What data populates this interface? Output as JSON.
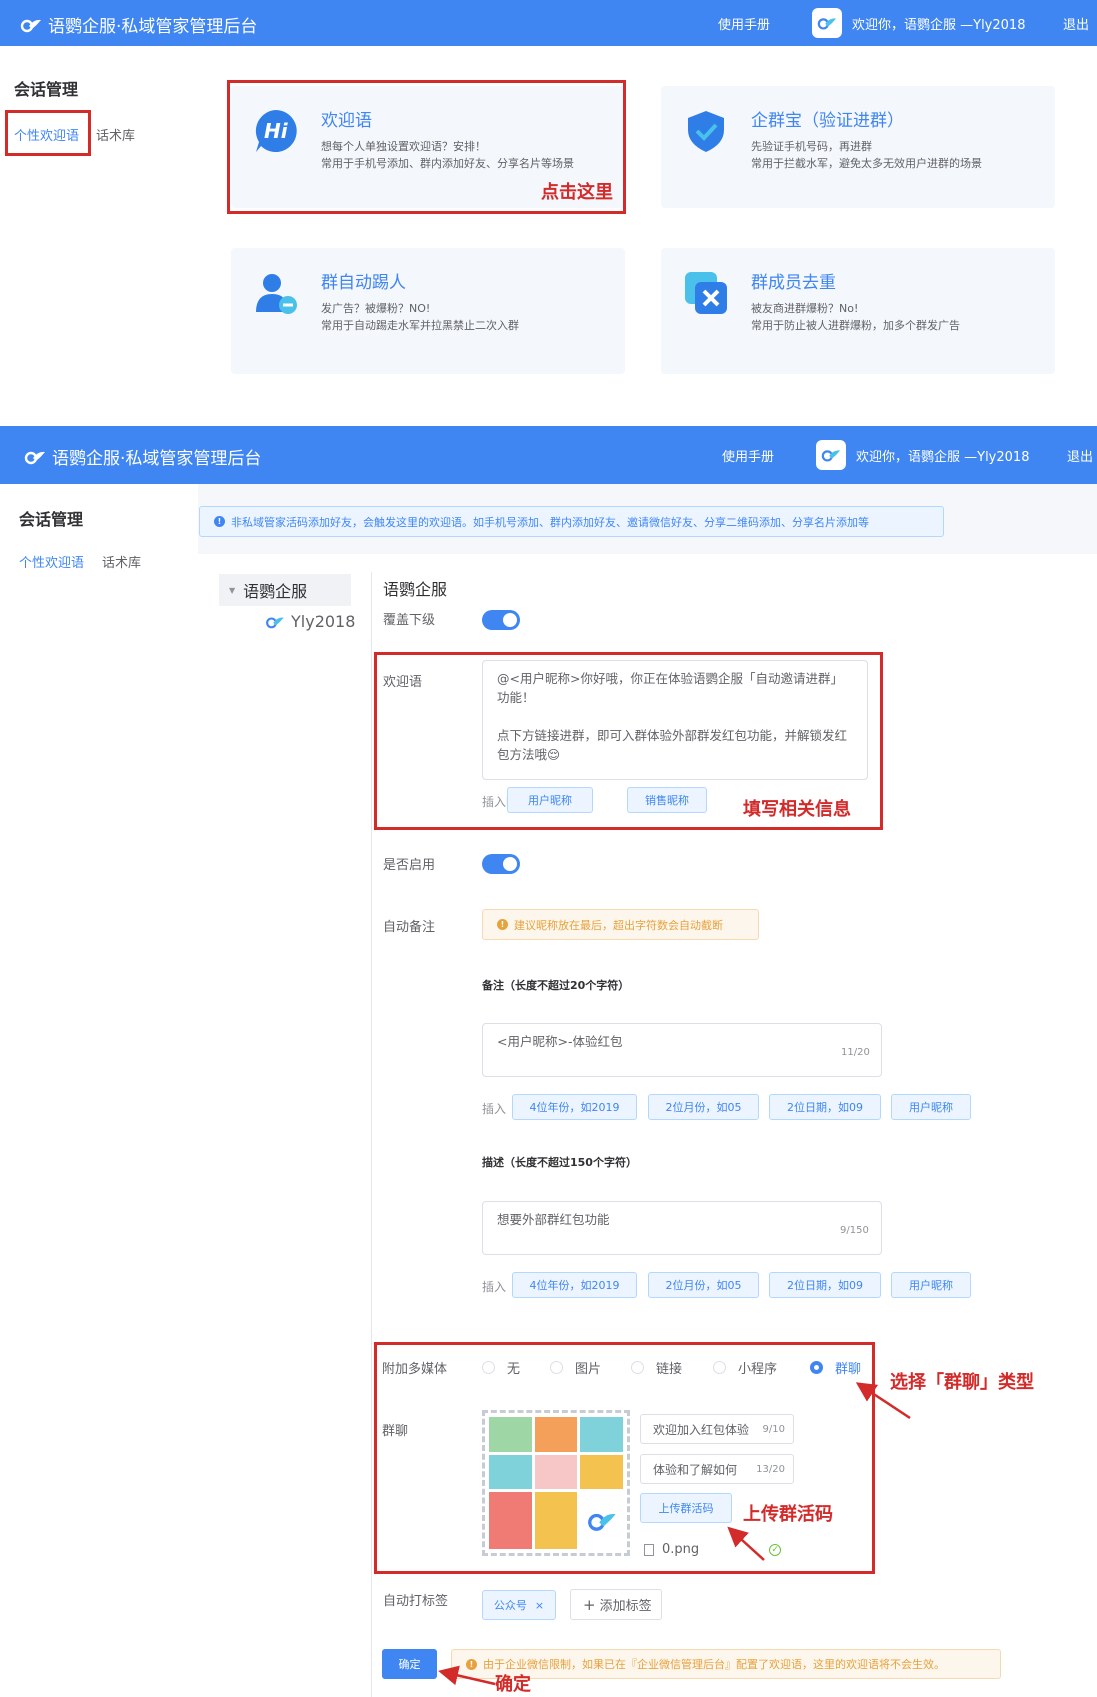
{
  "header": {
    "title": "语鹦企服·私域管家管理后台",
    "manual": "使用手册",
    "welcome": "欢迎你，语鹦企服 —Yly2018",
    "logout": "退出"
  },
  "sidebar": {
    "title": "会话管理",
    "items": [
      {
        "label": "个性欢迎语"
      },
      {
        "label": "话术库"
      }
    ]
  },
  "cards": [
    {
      "title": "欢迎语",
      "desc1": "想每个人单独设置欢迎语？安排！",
      "desc2": "常用于手机号添加、群内添加好友、分享名片等场景",
      "icon": "hi-bubble-icon"
    },
    {
      "title": "企群宝（验证进群）",
      "desc1": "先验证手机号码，再进群",
      "desc2": "常用于拦截水军，避免太多无效用户进群的场景",
      "icon": "shield-check-icon"
    },
    {
      "title": "群自动踢人",
      "desc1": "发广告？被爆粉？NO!",
      "desc2": "常用于自动踢走水军并拉黑禁止二次入群",
      "icon": "user-remove-icon"
    },
    {
      "title": "群成员去重",
      "desc1": "被友商进群爆粉？No!",
      "desc2": "常用于防止被人进群爆粉，加多个群发广告",
      "icon": "dedupe-x-icon"
    }
  ],
  "annotations": {
    "click_here": "点击这里",
    "fill_info": "填写相关信息",
    "select_group": "选择「群聊」类型",
    "upload_code": "上传群活码",
    "confirm": "确定"
  },
  "notice": "非私域管家活码添加好友，会触发这里的欢迎语。如手机号添加、群内添加好友、邀请微信好友、分享二维码添加、分享名片添加等",
  "tree": {
    "root": "语鹦企服",
    "child": "Yly2018"
  },
  "form": {
    "org_name": "语鹦企服",
    "cover_label": "覆盖下级",
    "welcome_label": "欢迎语",
    "welcome_text_1": "@<用户昵称>你好哦，你正在体验语鹦企服「自动邀请进群」功能！",
    "welcome_text_2": "点下方链接进群，即可入群体验外部群发红包功能，并解锁发红包方法哦😌",
    "insert_nickname": "插入昵称",
    "btn_user_nick": "用户昵称",
    "btn_sales_nick": "销售昵称",
    "enable_label": "是否启用",
    "auto_remark_label": "自动备注",
    "remark_tip": "建议昵称放在最后，超出字符数会自动截断",
    "remark_title": "备注（长度不超过20个字符）",
    "remark_text": "<用户昵称>-体验红包",
    "remark_count": "11/20",
    "insert": "插入",
    "btn_year": "4位年份，如2019",
    "btn_month": "2位月份，如05",
    "btn_day": "2位日期，如09",
    "btn_nick": "用户昵称",
    "desc_title": "描述（长度不超过150个字符）",
    "desc_text": "想要外部群红包功能",
    "desc_count": "9/150",
    "media_label": "附加多媒体",
    "media_options": [
      "无",
      "图片",
      "链接",
      "小程序",
      "群聊"
    ],
    "media_selected": "群聊",
    "group_label": "群聊",
    "group_title": "欢迎加入红包体验",
    "group_title_count": "9/10",
    "group_desc": "体验和了解如何",
    "group_desc_count": "13/20",
    "upload_btn": "上传群活码",
    "file_name": "0.png",
    "tag_label": "自动打标签",
    "tag": "公众号",
    "add_tag": "添加标签",
    "confirm_btn": "确定",
    "bottom_tip": "由于企业微信限制，如果已在『企业微信管理后台』配置了欢迎语，这里的欢迎语将不会生效。"
  },
  "colors": {
    "primary": "#3f86f3",
    "annotation_red": "#d32a2a",
    "warning": "#e6a23c"
  }
}
